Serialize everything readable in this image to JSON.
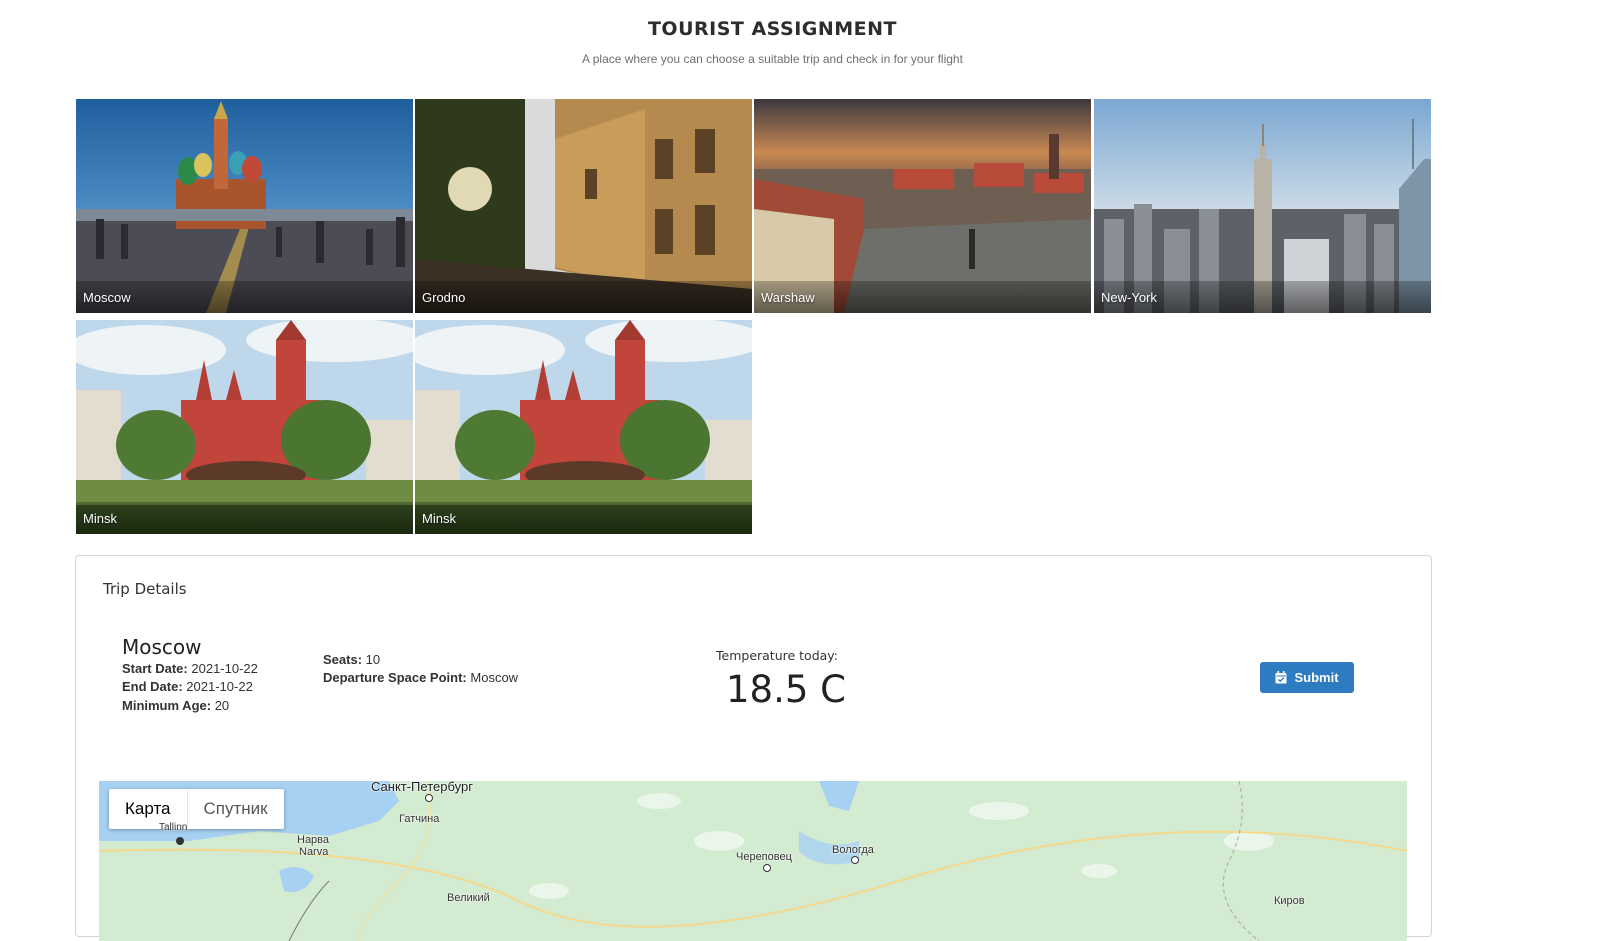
{
  "header": {
    "title": "TOURIST ASSIGNMENT",
    "subtitle": "A place where you can choose a suitable trip and check in for your flight"
  },
  "destinations": [
    {
      "label": "Moscow",
      "image": "st-basils-cathedral"
    },
    {
      "label": "Grodno",
      "image": "sunlit-street"
    },
    {
      "label": "Warshaw",
      "image": "old-town-square"
    },
    {
      "label": "New-York",
      "image": "manhattan-skyline"
    },
    {
      "label": "Minsk",
      "image": "red-church"
    },
    {
      "label": "Minsk",
      "image": "red-church"
    }
  ],
  "trip": {
    "section_title": "Trip Details",
    "city": "Moscow",
    "start_date_label": "Start Date:",
    "start_date": "2021-10-22",
    "end_date_label": "End Date:",
    "end_date": "2021-10-22",
    "min_age_label": "Minimum Age:",
    "min_age": "20",
    "seats_label": "Seats:",
    "seats": "10",
    "departure_label": "Departure Space Point:",
    "departure": "Moscow",
    "temperature_label": "Temperature today:",
    "temperature": "18.5 C",
    "submit_label": "Submit",
    "submit_icon": "calendar-check-icon"
  },
  "map": {
    "tab_map": "Карта",
    "tab_satellite": "Спутник",
    "cities": {
      "spb": "Санкт-Петербург",
      "gatchina": "Гатчина",
      "narva": "Нарва",
      "narva2": "Narva",
      "tallinn": "Tallinn",
      "cherepovets": "Череповец",
      "vologda": "Вологда",
      "velikiy": "Великий",
      "kirov": "Киров"
    }
  },
  "colors": {
    "accent": "#2d7bc0",
    "map_land": "#d3ebd1",
    "map_water": "#a6d1f2"
  }
}
